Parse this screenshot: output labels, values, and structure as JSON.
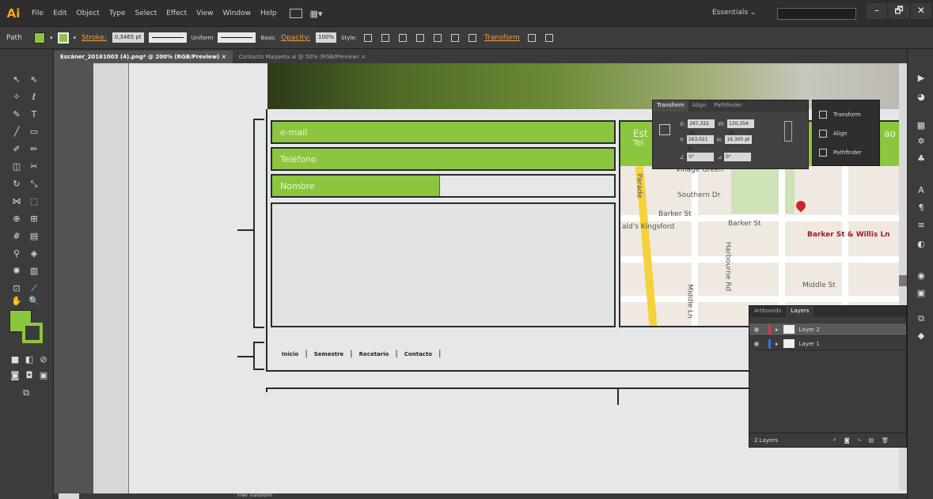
{
  "app": {
    "logo": "Ai",
    "menu": [
      "File",
      "Edit",
      "Object",
      "Type",
      "Select",
      "Effect",
      "View",
      "Window",
      "Help"
    ],
    "workspace": "Essentials ⌄",
    "window_buttons": [
      "–",
      "🗗",
      "✕"
    ]
  },
  "control_bar": {
    "selection": "Path",
    "stroke_label": "Stroke:",
    "stroke_weight": "0,3465 pt",
    "profile": "Uniform",
    "brush": "Basic",
    "opacity_label": "Opacity:",
    "opacity_value": "100%",
    "style_label": "Style:",
    "transform_link": "Transform"
  },
  "tabs": [
    {
      "label": "Escáner_20161003 (4).png* @ 200% (RGB/Preview)",
      "close": "×"
    },
    {
      "label": "Contacto Maqueta.ai @ 50% (RGB/Preview)",
      "close": "×"
    }
  ],
  "canvas": {
    "fields": {
      "email": "e-mail",
      "phone": "Telefono",
      "name": "Nombre"
    },
    "footer_links": [
      "Inicio",
      "Semestre",
      "Recetario",
      "Contacto"
    ],
    "map": {
      "header_line1": "Est",
      "header_line2": "Tel",
      "header_right": "ao",
      "streets": [
        "Village Green",
        "Southern Dr",
        "Barker St",
        "Barker St",
        "Middle St",
        "Harbourne Rd",
        "Middle Ln",
        "Parade"
      ],
      "place_label": "ald's Kingsford",
      "pin_label": "Barker St & Willis Ln"
    }
  },
  "transform_panel": {
    "tabs": [
      "Transform",
      "Align",
      "Pathfinder"
    ],
    "x_label": "X:",
    "x_value": "267,322 pt",
    "y_label": "Y:",
    "y_value": "263,021 pt",
    "w_label": "W:",
    "w_value": "120,354 pt",
    "h_label": "H:",
    "h_value": "16,305 pt",
    "angle_value": "0°",
    "shear_value": "0°"
  },
  "dock_panel": {
    "items": [
      "Transform",
      "Align",
      "Pathfinder"
    ]
  },
  "layers_panel": {
    "tabs": [
      "Artboards",
      "Layers"
    ],
    "layers": [
      {
        "name": "Layer 2",
        "color": "#e0344a",
        "selected": true
      },
      {
        "name": "Layer 1",
        "color": "#3a6be0",
        "selected": false
      }
    ],
    "count_label": "2 Layers"
  },
  "status": {
    "zoom": "200%",
    "text": "Free Transform"
  },
  "colors": {
    "accent_green": "#8cc63f",
    "pin_red": "#d0242b"
  }
}
